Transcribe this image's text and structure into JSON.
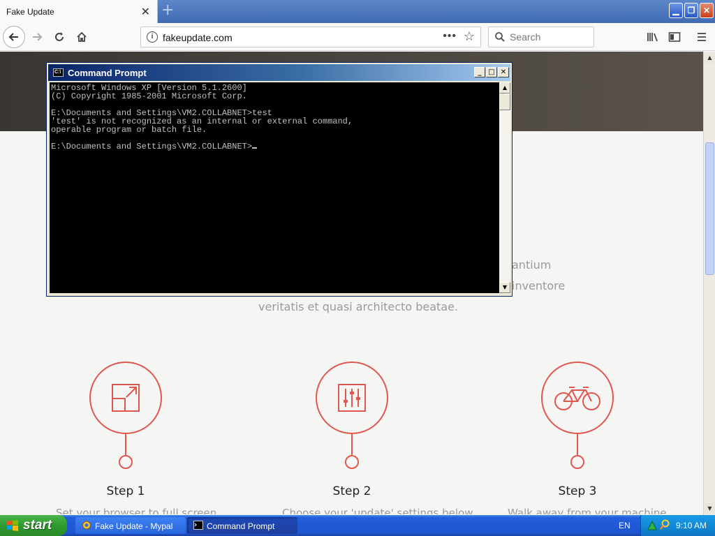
{
  "browser": {
    "tab": {
      "title": "Fake Update"
    },
    "url": "fakeupdate.com",
    "search_placeholder": "Search"
  },
  "page": {
    "intro_fragments": [
      "antium",
      "inventore",
      "veritatis et quasi architecto beatae."
    ],
    "steps": [
      {
        "title": "Step 1",
        "description": "Set your browser to full screen",
        "icon": "resize-icon"
      },
      {
        "title": "Step 2",
        "description": "Choose your 'update' settings below",
        "icon": "sliders-icon"
      },
      {
        "title": "Step 3",
        "description": "Walk away from your machine",
        "icon": "bicycle-icon"
      }
    ],
    "accent_color": "#e0574f"
  },
  "cmd": {
    "title": "Command Prompt",
    "lines": [
      "Microsoft Windows XP [Version 5.1.2600]",
      "(C) Copyright 1985-2001 Microsoft Corp.",
      "",
      "E:\\Documents and Settings\\VM2.COLLABNET>test",
      "'test' is not recognized as an internal or external command,",
      "operable program or batch file.",
      "",
      "E:\\Documents and Settings\\VM2.COLLABNET>"
    ]
  },
  "taskbar": {
    "start_label": "start",
    "items": [
      {
        "label": "Fake Update - Mypal",
        "active": false
      },
      {
        "label": "Command Prompt",
        "active": true
      }
    ],
    "language": "EN",
    "time": "9:10 AM"
  }
}
